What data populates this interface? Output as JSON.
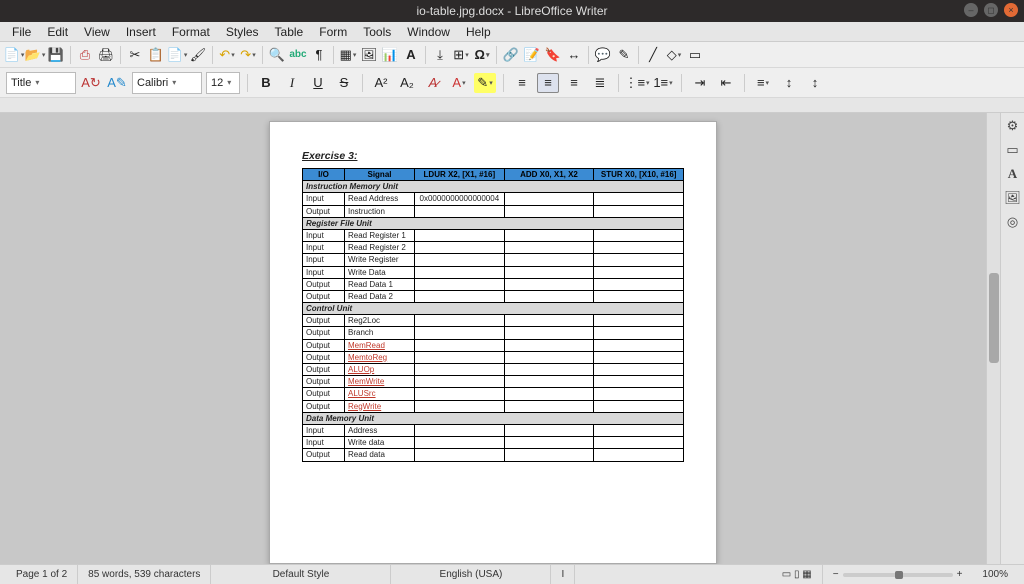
{
  "window": {
    "title": "io-table.jpg.docx - LibreOffice Writer"
  },
  "menu": {
    "items": [
      "File",
      "Edit",
      "View",
      "Insert",
      "Format",
      "Styles",
      "Table",
      "Form",
      "Tools",
      "Window",
      "Help"
    ]
  },
  "format_toolbar": {
    "style": "Title",
    "font": "Calibri",
    "size": "12"
  },
  "document": {
    "heading": "Exercise 3:",
    "headers": {
      "io": "I/O",
      "signal": "Signal",
      "c1": "LDUR X2, [X1, #16]",
      "c2": "ADD X0, X1, X2",
      "c3": "STUR X0, [X10, #16]"
    },
    "sections": [
      {
        "title": "Instruction Memory Unit",
        "rows": [
          {
            "io": "Input",
            "signal": "Read Address",
            "c1": "0x0000000000000004",
            "c2": "",
            "c3": ""
          },
          {
            "io": "Output",
            "signal": "Instruction",
            "c1": "",
            "c2": "",
            "c3": ""
          }
        ]
      },
      {
        "title": "Register File Unit",
        "rows": [
          {
            "io": "Input",
            "signal": "Read Register 1",
            "c1": "",
            "c2": "",
            "c3": ""
          },
          {
            "io": "Input",
            "signal": "Read Register 2",
            "c1": "",
            "c2": "",
            "c3": ""
          },
          {
            "io": "Input",
            "signal": "Write Register",
            "c1": "",
            "c2": "",
            "c3": ""
          },
          {
            "io": "Input",
            "signal": "Write Data",
            "c1": "",
            "c2": "",
            "c3": ""
          },
          {
            "io": "Output",
            "signal": "Read Data 1",
            "c1": "",
            "c2": "",
            "c3": ""
          },
          {
            "io": "Output",
            "signal": "Read Data 2",
            "c1": "",
            "c2": "",
            "c3": ""
          }
        ]
      },
      {
        "title": "Control Unit",
        "rows": [
          {
            "io": "Output",
            "signal": "Reg2Loc",
            "c1": "",
            "c2": "",
            "c3": ""
          },
          {
            "io": "Output",
            "signal": "Branch",
            "c1": "",
            "c2": "",
            "c3": ""
          },
          {
            "io": "Output",
            "signal": "MemRead",
            "red": true,
            "c1": "",
            "c2": "",
            "c3": ""
          },
          {
            "io": "Output",
            "signal": "MemtoReg",
            "red": true,
            "c1": "",
            "c2": "",
            "c3": ""
          },
          {
            "io": "Output",
            "signal": "ALUOp",
            "red": true,
            "c1": "",
            "c2": "",
            "c3": ""
          },
          {
            "io": "Output",
            "signal": "MemWrite",
            "red": true,
            "c1": "",
            "c2": "",
            "c3": ""
          },
          {
            "io": "Output",
            "signal": "ALUSrc",
            "red": true,
            "c1": "",
            "c2": "",
            "c3": ""
          },
          {
            "io": "Output",
            "signal": "RegWrite",
            "red": true,
            "c1": "",
            "c2": "",
            "c3": ""
          }
        ]
      },
      {
        "title": "Data Memory Unit",
        "rows": [
          {
            "io": "Input",
            "signal": "Address",
            "c1": "",
            "c2": "",
            "c3": ""
          },
          {
            "io": "Input",
            "signal": "Write data",
            "c1": "",
            "c2": "",
            "c3": ""
          },
          {
            "io": "Output",
            "signal": "Read data",
            "c1": "",
            "c2": "",
            "c3": ""
          }
        ]
      }
    ]
  },
  "status": {
    "page": "Page 1 of 2",
    "words": "85 words, 539 characters",
    "style": "Default Style",
    "lang": "English (USA)",
    "insert": "I",
    "zoom": "100%"
  }
}
